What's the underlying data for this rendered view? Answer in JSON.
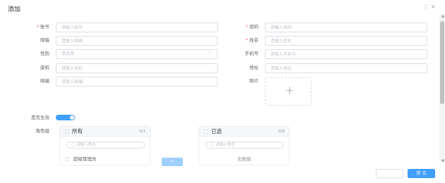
{
  "dialog": {
    "title": "添加",
    "icons": {
      "fullscreen": "fullscreen-icon",
      "close": "close-icon"
    }
  },
  "form": {
    "account": {
      "label": "账号",
      "required": true,
      "placeholder": "请输入账号"
    },
    "password": {
      "label": "密码",
      "required": true,
      "placeholder": "请输入密码"
    },
    "email": {
      "label": "邮箱",
      "required": false,
      "placeholder": "请输入邮箱"
    },
    "name": {
      "label": "姓名",
      "required": true,
      "placeholder": "请输入姓名"
    },
    "gender": {
      "label": "性别",
      "placeholder": "请选择"
    },
    "mobile": {
      "label": "手机号",
      "placeholder": "请输入手机号"
    },
    "phone": {
      "label": "座机",
      "placeholder": "请输入座机"
    },
    "address": {
      "label": "地址",
      "placeholder": "请输入地址"
    },
    "postcode": {
      "label": "邮编",
      "placeholder": "请输入邮编"
    },
    "photo": {
      "label": "照片",
      "icon": "plus-icon"
    },
    "enabled": {
      "label": "是否生效",
      "on": true
    },
    "roles": {
      "label": "角色组"
    }
  },
  "transfer": {
    "left": {
      "title": "所有",
      "count": "0/1",
      "filter_placeholder": "请输入角色",
      "items": [
        "超级管理员"
      ]
    },
    "right": {
      "title": "已选",
      "count": "0/0",
      "filter_placeholder": "请输入角色",
      "empty_text": "无数据"
    },
    "arrow": "<"
  },
  "footer": {
    "cancel_label": "",
    "submit_label": "提 交"
  },
  "colors": {
    "primary": "#409eff",
    "required": "#f56c6c",
    "border": "#dcdfe6",
    "disabled_primary": "#a0cfff"
  }
}
